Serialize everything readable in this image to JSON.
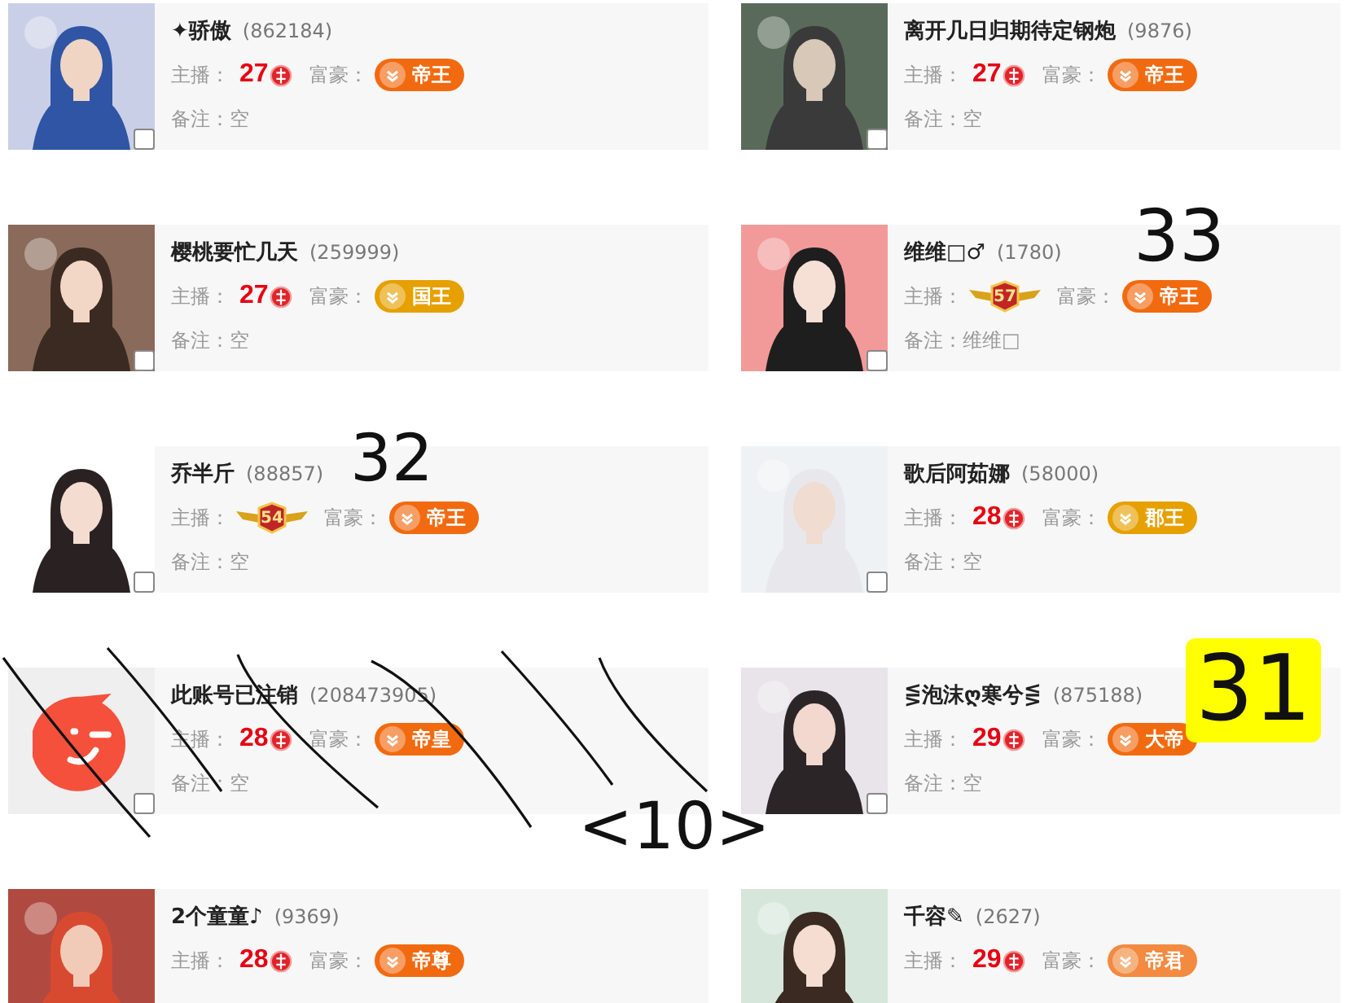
{
  "users": [
    {
      "name": "✦骄傲",
      "id": "(862184)",
      "anchor_label": "主播：",
      "anchor": {
        "kind": "number",
        "text": "27"
      },
      "wealth_label": "富豪：",
      "wealth": {
        "text": "帝王",
        "color": "#f26a10"
      },
      "remark": "备注：空",
      "checked": false,
      "account_deleted": false
    },
    {
      "name": "离开几日归期待定钢炮",
      "id": "(9876)",
      "anchor_label": "主播：",
      "anchor": {
        "kind": "number",
        "text": "27"
      },
      "wealth_label": "富豪：",
      "wealth": {
        "text": "帝王",
        "color": "#f26a10"
      },
      "remark": "备注：空",
      "checked": false,
      "account_deleted": false
    },
    {
      "name": "樱桃要忙几天",
      "id": "(259999)",
      "anchor_label": "主播：",
      "anchor": {
        "kind": "number",
        "text": "27"
      },
      "wealth_label": "富豪：",
      "wealth": {
        "text": "国王",
        "color": "#e6a000"
      },
      "remark": "备注：空",
      "checked": false,
      "account_deleted": false
    },
    {
      "name": "维维□♂",
      "id": "(1780)",
      "anchor_label": "主播：",
      "anchor": {
        "kind": "medal",
        "text": "57"
      },
      "wealth_label": "富豪：",
      "wealth": {
        "text": "帝王",
        "color": "#f26a10"
      },
      "remark": "备注：维维□",
      "checked": false,
      "account_deleted": false
    },
    {
      "name": "乔半斤",
      "id": "(88857)",
      "anchor_label": "主播：",
      "anchor": {
        "kind": "medal",
        "text": "54"
      },
      "wealth_label": "富豪：",
      "wealth": {
        "text": "帝王",
        "color": "#f26a10"
      },
      "remark": "备注：空",
      "checked": false,
      "account_deleted": false
    },
    {
      "name": "歌后阿茹娜",
      "id": "(58000)",
      "anchor_label": "主播：",
      "anchor": {
        "kind": "number",
        "text": "28"
      },
      "wealth_label": "富豪：",
      "wealth": {
        "text": "郡王",
        "color": "#e6a000"
      },
      "remark": "备注：空",
      "checked": false,
      "account_deleted": false
    },
    {
      "name": "此账号已注销",
      "id": "(208473905)",
      "anchor_label": "主播：",
      "anchor": {
        "kind": "number",
        "text": "28"
      },
      "wealth_label": "富豪：",
      "wealth": {
        "text": "帝皇",
        "color": "#f26a10"
      },
      "remark": "备注：空",
      "checked": false,
      "account_deleted": true
    },
    {
      "name": "⋚泡沫ღ寒兮⋚",
      "id": "(875188)",
      "anchor_label": "主播：",
      "anchor": {
        "kind": "number",
        "text": "29"
      },
      "wealth_label": "富豪：",
      "wealth": {
        "text": "大帝",
        "color": "#f26a10"
      },
      "remark": "备注：空",
      "checked": false,
      "account_deleted": false
    },
    {
      "name": "2个童童♪",
      "id": "(9369)",
      "anchor_label": "主播：",
      "anchor": {
        "kind": "number",
        "text": "28"
      },
      "wealth_label": "富豪：",
      "wealth": {
        "text": "帝尊",
        "color": "#f26a10"
      },
      "account_deleted": false
    },
    {
      "name": "千容✎",
      "id": "(2627)",
      "anchor_label": "主播：",
      "anchor": {
        "kind": "number",
        "text": "29"
      },
      "wealth_label": "富豪：",
      "wealth": {
        "text": "帝君",
        "color": "#f28a40"
      },
      "account_deleted": false
    }
  ],
  "annotations": [
    {
      "kind": "number",
      "text": "33"
    },
    {
      "kind": "number",
      "text": "32"
    },
    {
      "kind": "highlighted",
      "text": "31"
    },
    {
      "kind": "number",
      "text": "<10>"
    },
    {
      "kind": "strikes"
    }
  ]
}
